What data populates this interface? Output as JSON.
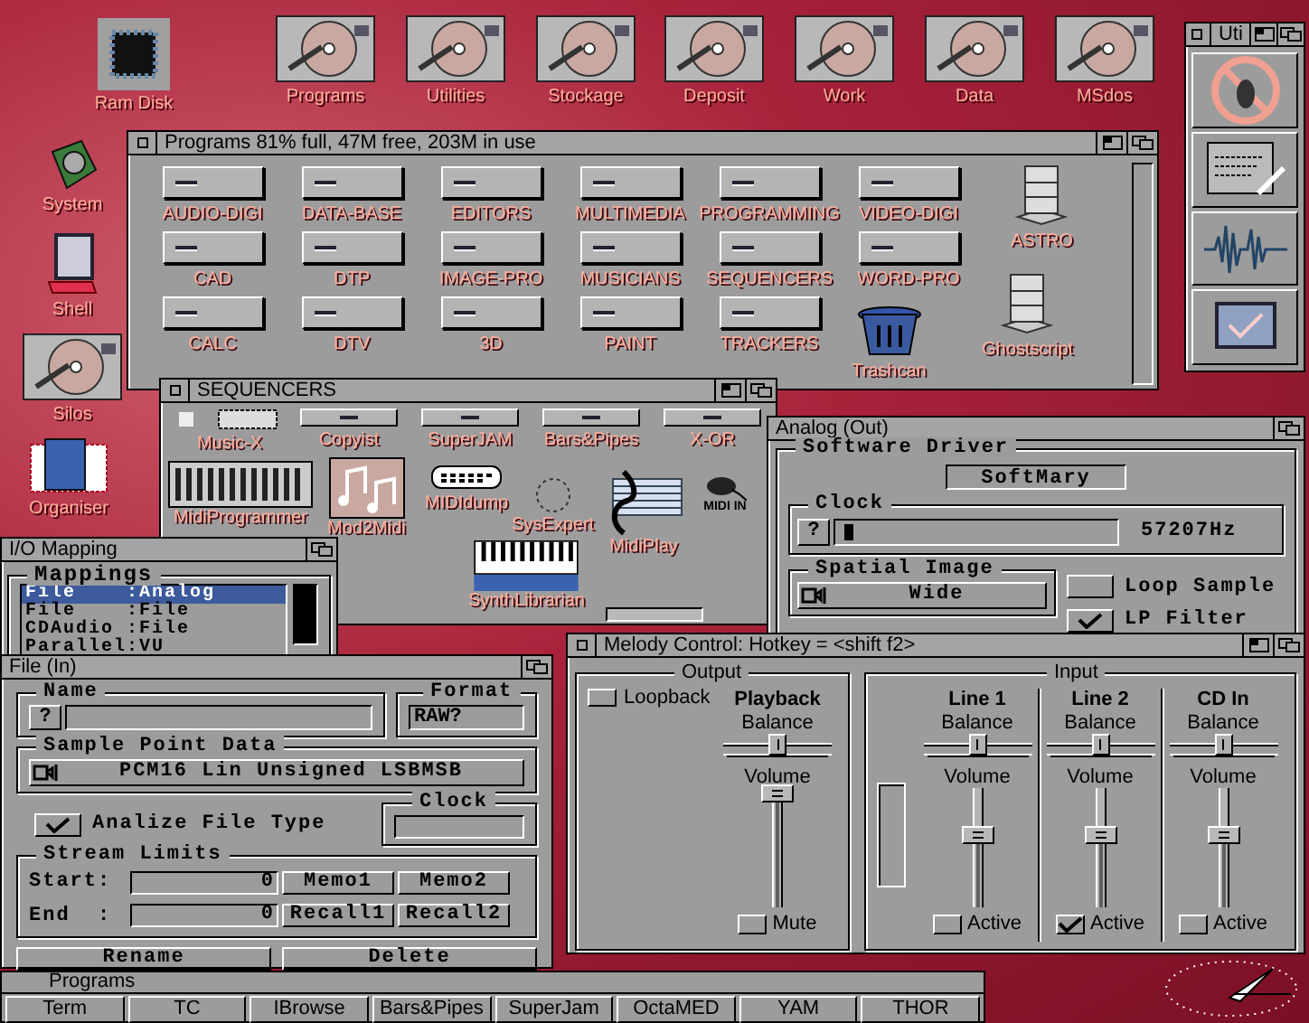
{
  "desktop_icons": [
    {
      "label": "Ram Disk",
      "kind": "chip"
    },
    {
      "label": "Programs",
      "kind": "disk"
    },
    {
      "label": "Utilities",
      "kind": "disk"
    },
    {
      "label": "Stockage",
      "kind": "disk"
    },
    {
      "label": "Deposit",
      "kind": "disk"
    },
    {
      "label": "Work",
      "kind": "disk"
    },
    {
      "label": "Data",
      "kind": "disk"
    },
    {
      "label": "MSdos",
      "kind": "disk"
    },
    {
      "label": "System",
      "kind": "drive"
    },
    {
      "label": "Shell",
      "kind": "shell"
    },
    {
      "label": "Silos",
      "kind": "disk"
    },
    {
      "label": "Organiser",
      "kind": "book"
    }
  ],
  "uti_window": {
    "title": "Uti"
  },
  "programs_window": {
    "title": "Programs  81% full, 47M free, 203M in use",
    "drawers": [
      {
        "label": "AUDIO-DIGI"
      },
      {
        "label": "DATA-BASE"
      },
      {
        "label": "EDITORS"
      },
      {
        "label": "MULTIMEDIA"
      },
      {
        "label": "PROGRAMMING"
      },
      {
        "label": "VIDEO-DIGI"
      },
      {
        "label": "CAD"
      },
      {
        "label": "DTP"
      },
      {
        "label": "IMAGE-PRO"
      },
      {
        "label": "MUSICIANS"
      },
      {
        "label": "SEQUENCERS"
      },
      {
        "label": "WORD-PRO"
      },
      {
        "label": "CALC"
      },
      {
        "label": "DTV"
      },
      {
        "label": "3D"
      },
      {
        "label": "PAINT"
      },
      {
        "label": "TRACKERS"
      }
    ],
    "icons": [
      {
        "label": "ASTRO",
        "kind": "server"
      },
      {
        "label": "Ghostscript",
        "kind": "server"
      },
      {
        "label": "Trashcan",
        "kind": "trash"
      }
    ]
  },
  "sequencers_window": {
    "title": "SEQUENCERS",
    "drawers": [
      {
        "label": "Music-X"
      },
      {
        "label": "Copyist"
      },
      {
        "label": "SuperJAM"
      },
      {
        "label": "Bars&Pipes"
      },
      {
        "label": "X-OR"
      }
    ],
    "tools": [
      {
        "label": "MidiProgrammer",
        "kind": "faders"
      },
      {
        "label": "Mod2Midi",
        "kind": "notes"
      },
      {
        "label": "MIDIdump",
        "kind": "bubble"
      },
      {
        "label": "SysExpert",
        "kind": "dial"
      },
      {
        "label": "MidiPlay",
        "kind": "staff"
      },
      {
        "label": "MIDI IN",
        "kind": "plug"
      },
      {
        "label": "SynthLibrarian",
        "kind": "keyboard"
      }
    ]
  },
  "analog_window": {
    "title": "Analog (Out)",
    "driver_group": "Software Driver",
    "driver": "SoftMary",
    "clock_group": "Clock",
    "clock_button": "?",
    "clock_slider": {
      "level": 0.02
    },
    "clock_reading": "57207Hz",
    "spatial_group": "Spatial Image",
    "spatial_value": "Wide",
    "options": [
      {
        "label": "Loop Sample",
        "checked": false
      },
      {
        "label": "LP Filter",
        "checked": true
      }
    ]
  },
  "io_window": {
    "title": "I/O Mapping",
    "group": "Mappings",
    "rows": [
      {
        "text": "File    :Analog",
        "selected": true
      },
      {
        "text": "File    :File",
        "selected": false
      },
      {
        "text": "CDAudio :File",
        "selected": false
      },
      {
        "text": "Parallel:VU",
        "selected": false
      }
    ]
  },
  "file_window": {
    "title": "File (In)",
    "name_group": "Name",
    "name_button": "?",
    "format_group": "Format",
    "format": "RAW?",
    "sample_group": "Sample Point Data",
    "sample": "PCM16 Lin Unsigned LSBMSB",
    "analyze": {
      "label": "Analize File Type",
      "checked": true
    },
    "clock_group": "Clock",
    "stream_group": "Stream Limits",
    "limits": [
      {
        "label": "Start:",
        "value": "0",
        "buttons": [
          "Memo1",
          "Memo2"
        ]
      },
      {
        "label": "End  :",
        "value": "0",
        "buttons": [
          "Recall1",
          "Recall2"
        ]
      }
    ],
    "actions": [
      "Rename",
      "Delete"
    ]
  },
  "melody_window": {
    "title": "Melody Control: Hotkey = <shift f2>",
    "output_group": "Output",
    "loopback": {
      "label": "Loopback",
      "checked": false
    },
    "input_group": "Input",
    "channels": [
      {
        "name": "Playback",
        "balance": {
          "label": "Balance",
          "level": 0.5
        },
        "volume": {
          "label": "Volume",
          "level": 0.95
        },
        "check_label": "Mute",
        "checked": false
      },
      {
        "name": "Line 1",
        "balance": {
          "label": "Balance",
          "level": 0.5
        },
        "volume": {
          "label": "Volume",
          "level": 0.6
        },
        "check_label": "Active",
        "checked": false
      },
      {
        "name": "Line 2",
        "balance": {
          "label": "Balance",
          "level": 0.5
        },
        "volume": {
          "label": "Volume",
          "level": 0.6
        },
        "check_label": "Active",
        "checked": true
      },
      {
        "name": "CD In",
        "balance": {
          "label": "Balance",
          "level": 0.5
        },
        "volume": {
          "label": "Volume",
          "level": 0.6
        },
        "check_label": "Active",
        "checked": false
      }
    ]
  },
  "taskbar": {
    "title": "Programs",
    "buttons": [
      "Term",
      "TC",
      "IBrowse",
      "Bars&Pipes",
      "SuperJam",
      "OctaMED",
      "YAM",
      "THOR"
    ]
  }
}
